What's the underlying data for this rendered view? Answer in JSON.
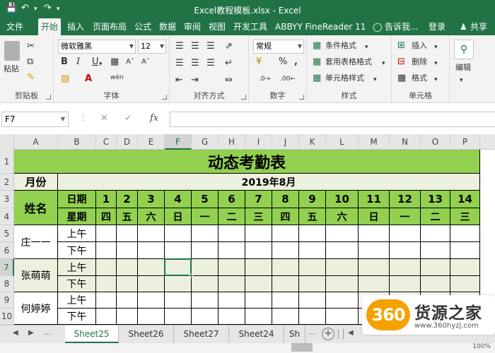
{
  "titlebar": {
    "title": "Excel教程模板.xlsx - Excel",
    "save_icon": "save-icon",
    "undo_icon": "undo-icon",
    "redo_icon": "redo-icon"
  },
  "tabs": [
    {
      "label": "文件"
    },
    {
      "label": "开始"
    },
    {
      "label": "插入"
    },
    {
      "label": "页面布局"
    },
    {
      "label": "公式"
    },
    {
      "label": "数据"
    },
    {
      "label": "审阅"
    },
    {
      "label": "视图"
    },
    {
      "label": "开发工具"
    },
    {
      "label": "ABBYY FineReader 11"
    }
  ],
  "tell_me": "告诉我...",
  "login": "登录",
  "share": "共享",
  "ribbon": {
    "clipboard": {
      "label": "剪贴板",
      "paste": "粘贴"
    },
    "font": {
      "label": "字体",
      "name": "微软雅黑",
      "size": "12",
      "bold": "B",
      "italic": "I",
      "underline": "U",
      "wen": "wén"
    },
    "alignment": {
      "label": "对齐方式"
    },
    "number": {
      "label": "数字",
      "format": "常规",
      "percent": "%"
    },
    "styles": {
      "label": "样式",
      "conditional": "条件格式",
      "table": "套用表格格式",
      "cell": "单元格样式"
    },
    "cells": {
      "label": "单元格",
      "insert": "插入",
      "delete": "删除",
      "format": "格式"
    },
    "editing": {
      "label": "编辑"
    }
  },
  "formula_bar": {
    "name_box": "F7",
    "fx": "fx",
    "value": ""
  },
  "columns": [
    "A",
    "B",
    "C",
    "D",
    "E",
    "F",
    "G",
    "H",
    "I",
    "J",
    "K",
    "L",
    "M",
    "N",
    "O",
    "P"
  ],
  "selected_column": "F",
  "rows": [
    "1",
    "2",
    "3",
    "4",
    "5",
    "6",
    "7",
    "8",
    "9",
    "10"
  ],
  "selected_row": "7",
  "sheet": {
    "title": "动态考勤表",
    "month_label": "月份",
    "month_value": "2019年8月",
    "name_header": "姓名",
    "date_header": "日期",
    "weekday_header": "星期",
    "days": [
      "1",
      "2",
      "3",
      "4",
      "5",
      "6",
      "7",
      "8",
      "9",
      "10",
      "11",
      "12",
      "13",
      "14"
    ],
    "weekdays": [
      "四",
      "五",
      "六",
      "日",
      "一",
      "二",
      "三",
      "四",
      "五",
      "六",
      "日",
      "一",
      "二",
      "三"
    ],
    "employees": [
      {
        "name": "庄一一",
        "am": "上午",
        "pm": "下午"
      },
      {
        "name": "张萌萌",
        "am": "上午",
        "pm": "下午"
      },
      {
        "name": "何婷婷",
        "am": "上午",
        "pm": "下午"
      }
    ]
  },
  "sheet_tabs": [
    "Sheet25",
    "Sheet26",
    "Sheet27",
    "Sheet24",
    "Sh"
  ],
  "active_sheet": "Sheet25",
  "status": {
    "zoom": "100%"
  },
  "watermark": {
    "logo": "360",
    "name": "货源之家",
    "url": "www.360hyzj.com"
  },
  "colors": {
    "excel_green": "#217346",
    "header_green": "#92d050",
    "light_green": "#ebf1de",
    "logo_orange": "#f5a100"
  }
}
